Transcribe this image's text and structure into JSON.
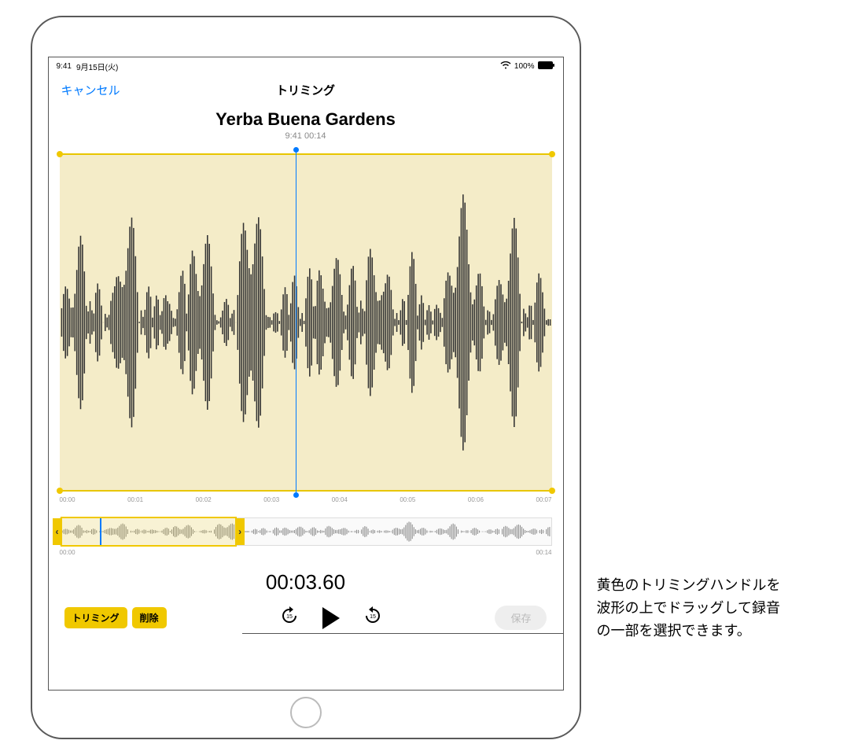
{
  "status": {
    "time": "9:41",
    "date": "9月15日(火)",
    "wifi": "wifi",
    "battery": "100%"
  },
  "nav": {
    "cancel": "キャンセル",
    "title": "トリミング"
  },
  "recording": {
    "title": "Yerba Buena Gardens",
    "subtitle": "9:41  00:14"
  },
  "ticks": {
    "t0": "00:00",
    "t1": "00:01",
    "t2": "00:02",
    "t3": "00:03",
    "t4": "00:04",
    "t5": "00:05",
    "t6": "00:06",
    "t7": "00:07"
  },
  "overview": {
    "start": "00:00",
    "end": "00:14"
  },
  "timer": "00:03.60",
  "controls": {
    "trim": "トリミング",
    "delete": "削除",
    "save": "保存",
    "back15": "15",
    "fwd15": "15"
  },
  "callout": {
    "line1": "黄色のトリミングハンドルを",
    "line2": "波形の上でドラッグして録音",
    "line3": "の一部を選択できます。"
  }
}
